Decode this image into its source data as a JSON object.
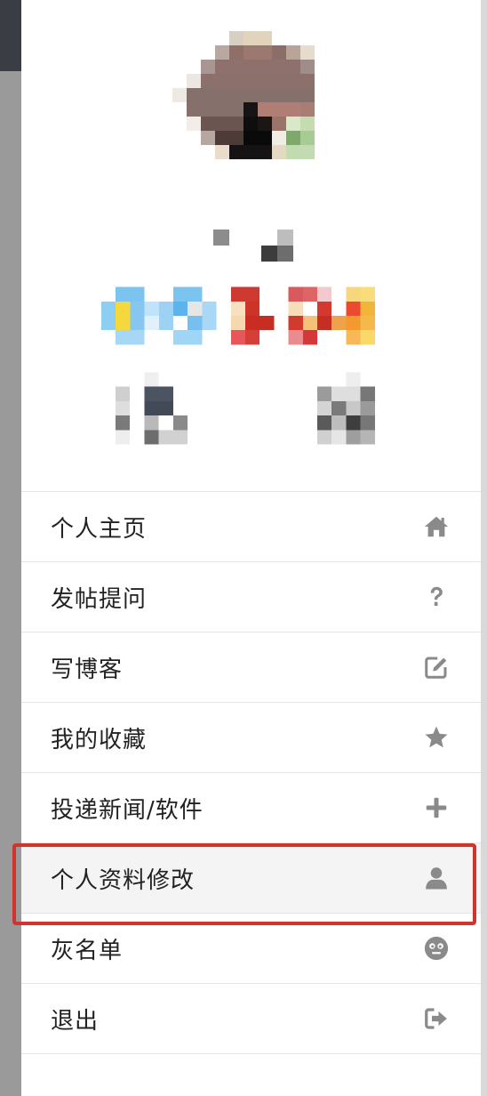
{
  "profile": {
    "avatar_icon": "pixelated-avatar",
    "name_icon": "pixelated-username",
    "badges_icon": "pixelated-badges",
    "stats_icon": "pixelated-stats"
  },
  "menu": {
    "items": [
      {
        "label": "个人主页",
        "icon": "home-icon"
      },
      {
        "label": "发帖提问",
        "icon": "question-icon"
      },
      {
        "label": "写博客",
        "icon": "edit-icon"
      },
      {
        "label": "我的收藏",
        "icon": "star-icon"
      },
      {
        "label": "投递新闻/软件",
        "icon": "plus-icon"
      },
      {
        "label": "个人资料修改",
        "icon": "user-icon"
      },
      {
        "label": "灰名单",
        "icon": "meh-face-icon"
      },
      {
        "label": "退出",
        "icon": "sign-out-icon"
      }
    ]
  },
  "colors": {
    "highlight": "#d0342c",
    "icon": "#8a8a8a"
  }
}
